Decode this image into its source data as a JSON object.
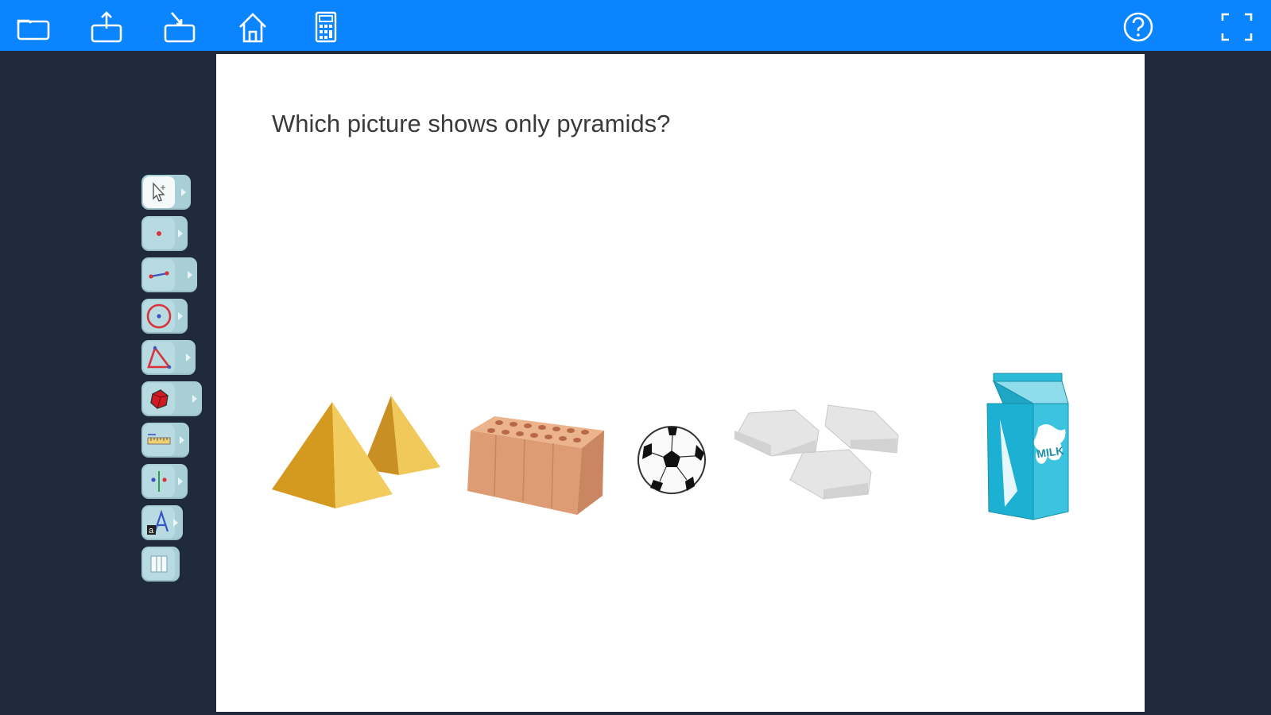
{
  "topbar": {
    "color": "#0a84ff",
    "buttons": [
      {
        "name": "folder-icon"
      },
      {
        "name": "folder-upload-icon"
      },
      {
        "name": "folder-download-icon"
      },
      {
        "name": "home-icon"
      },
      {
        "name": "calculator-icon"
      },
      {
        "name": "help-icon"
      },
      {
        "name": "fullscreen-icon"
      }
    ]
  },
  "question": {
    "text": "Which picture shows only pyramids?"
  },
  "toolbox": {
    "tools": [
      {
        "name": "move-tool",
        "icon": "cursor-icon"
      },
      {
        "name": "point-tool",
        "icon": "point-icon"
      },
      {
        "name": "line-tool",
        "icon": "line-segment-icon"
      },
      {
        "name": "circle-tool",
        "icon": "circle-icon"
      },
      {
        "name": "polygon-tool",
        "icon": "triangle-icon"
      },
      {
        "name": "solid-tool",
        "icon": "solid-icon"
      },
      {
        "name": "measure-tool",
        "icon": "ruler-icon"
      },
      {
        "name": "transform-tool",
        "icon": "reflect-icon"
      },
      {
        "name": "text-tool",
        "icon": "text-icon"
      },
      {
        "name": "table-tool",
        "icon": "table-icon"
      }
    ]
  },
  "answers": [
    {
      "name": "pyramids-picture"
    },
    {
      "name": "brick-picture"
    },
    {
      "name": "soccer-ball-picture"
    },
    {
      "name": "hexagon-tiles-picture"
    },
    {
      "name": "milk-carton-picture",
      "label": "MILK"
    }
  ]
}
